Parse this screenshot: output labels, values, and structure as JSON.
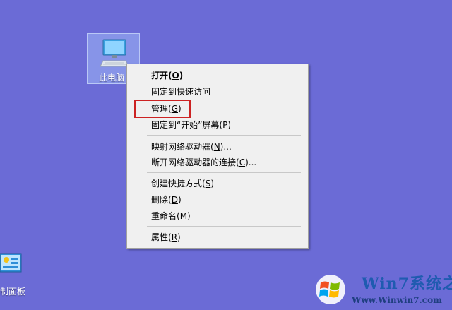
{
  "desktop": {
    "background_color": "#6b6bd6",
    "icons": [
      {
        "label": "此电脑",
        "icon": "computer-icon"
      },
      {
        "label": "制面板",
        "icon": "control-panel-icon"
      }
    ]
  },
  "context_menu": {
    "items": [
      {
        "text": "打开(",
        "accel": "O",
        "suffix": ")",
        "bold": true
      },
      {
        "text": "固定到快速访问",
        "accel": "",
        "suffix": ""
      },
      {
        "text": "管理(",
        "accel": "G",
        "suffix": ")"
      },
      {
        "text": "固定到“开始”屏幕(",
        "accel": "P",
        "suffix": ")"
      },
      {
        "text": "映射网络驱动器(",
        "accel": "N",
        "suffix": ")..."
      },
      {
        "text": "断开网络驱动器的连接(",
        "accel": "C",
        "suffix": ")..."
      },
      {
        "text": "创建快捷方式(",
        "accel": "S",
        "suffix": ")"
      },
      {
        "text": "删除(",
        "accel": "D",
        "suffix": ")"
      },
      {
        "text": "重命名(",
        "accel": "M",
        "suffix": ")"
      },
      {
        "text": "属性(",
        "accel": "R",
        "suffix": ")"
      }
    ],
    "highlight_color": "#cc2222"
  },
  "watermark": {
    "brand": "Win7系统之家",
    "url": "Www.Winwin7.com"
  }
}
